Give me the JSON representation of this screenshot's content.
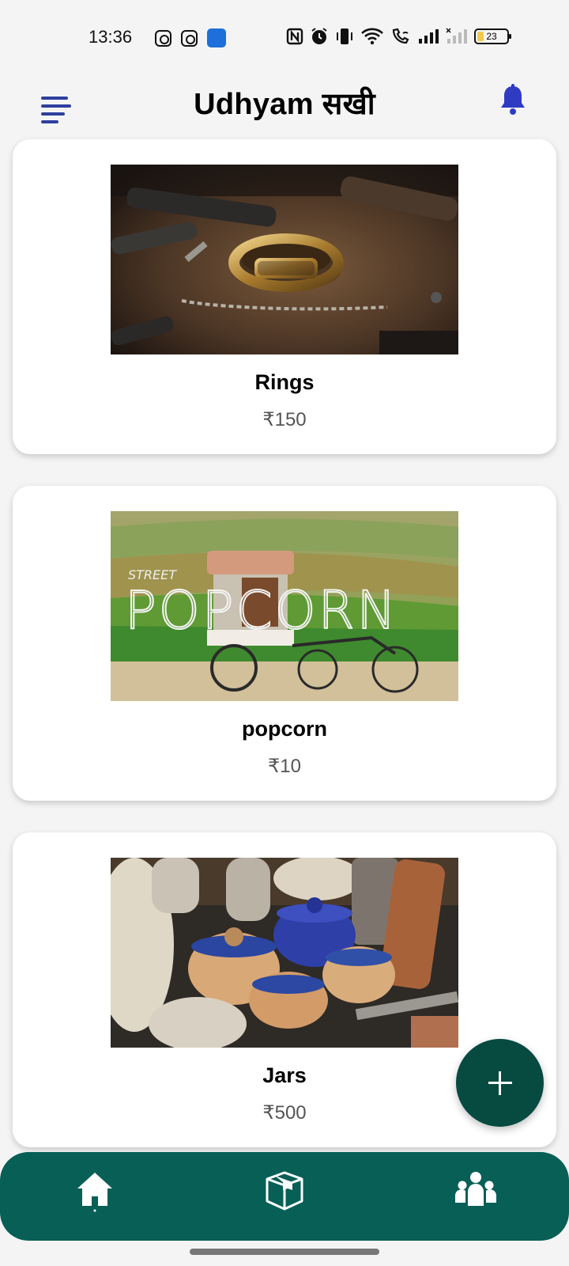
{
  "status_bar": {
    "time": "13:36",
    "left_icons": [
      "instagram-icon",
      "instagram-icon",
      "app-update-icon"
    ],
    "right_icons": [
      "nfc-icon",
      "alarm-icon",
      "vibrate-icon",
      "wifi-icon",
      "wifi-call-icon",
      "signal-icon",
      "signal-weak-icon",
      "battery-icon"
    ],
    "battery_level": "23",
    "battery_fraction": 0.23
  },
  "app_bar": {
    "title": "Udhyam सखी",
    "menu_icon": "menu-icon",
    "notification_icon": "bell-icon"
  },
  "products": [
    {
      "name": "Rings",
      "price": "₹150",
      "image": "ring-photo"
    },
    {
      "name": "popcorn",
      "price": "₹10",
      "image": "popcorn-cart-photo"
    },
    {
      "name": "Jars",
      "price": "₹500",
      "image": "ceramic-jars-photo"
    }
  ],
  "fab": {
    "icon": "plus-icon"
  },
  "bottom_nav": {
    "items": [
      {
        "id": "home",
        "icon": "home-icon"
      },
      {
        "id": "products",
        "icon": "box-icon"
      },
      {
        "id": "community",
        "icon": "group-icon"
      }
    ]
  },
  "colors": {
    "primary": "#075f56",
    "fab": "#064a40",
    "menu_icon": "#2e3f9e",
    "bell_icon": "#2f3bc2",
    "background": "#f4f4f4",
    "card": "#ffffff"
  }
}
